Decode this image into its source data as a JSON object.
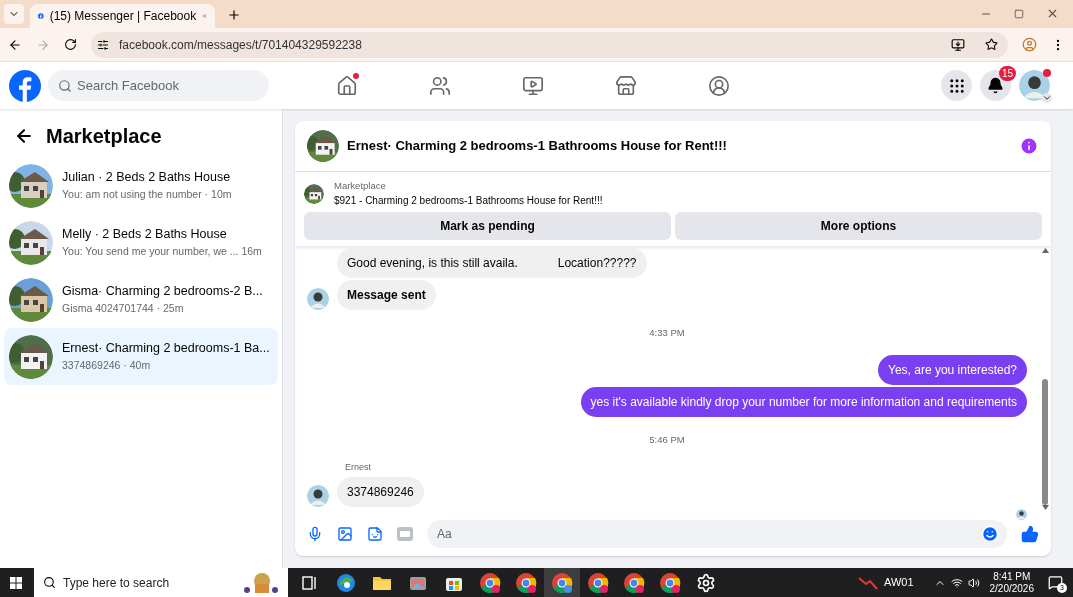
{
  "browser": {
    "tab_title": "(15) Messenger | Facebook",
    "url": "facebook.com/messages/t/701404329592238"
  },
  "header": {
    "search_placeholder": "Search Facebook",
    "nav": [
      {
        "kind": "home",
        "has_dot": true
      },
      {
        "kind": "friends",
        "has_dot": false
      },
      {
        "kind": "video",
        "has_dot": false
      },
      {
        "kind": "marketplace",
        "has_dot": false
      },
      {
        "kind": "groups",
        "has_dot": false
      }
    ],
    "notification_count": "15"
  },
  "sidebar": {
    "title": "Marketplace",
    "conversations": [
      {
        "title": "Julian · 2 Beds 2 Baths House",
        "preview": "You: am not using the number · 10m",
        "selected": false
      },
      {
        "title": "Melly · 2 Beds 2 Baths House",
        "preview": "You: You send me your number, we ...  16m",
        "selected": false
      },
      {
        "title": "Gisma· Charming 2 bedrooms-2 B...",
        "preview": "Gisma 4024701744 · 25m",
        "selected": false
      },
      {
        "title": "Ernest· Charming 2 bedrooms-1 Ba...",
        "preview": "3374869246 · 40m",
        "selected": true
      }
    ]
  },
  "chat": {
    "title": "Ernest· Charming 2 bedrooms-1 Bathrooms House for Rent!!!",
    "listing": {
      "label": "Marketplace",
      "title": "$921 - Charming 2 bedrooms-1 Bathrooms House for Rent!!!"
    },
    "buttons": [
      "Mark as pending",
      "More options"
    ],
    "messages": [
      {
        "kind": "incoming",
        "parts": [
          "Good evening, is this still availa.",
          "Location?????"
        ],
        "avatar": false
      },
      {
        "kind": "incoming",
        "parts": [
          "Message sent"
        ],
        "avatar": true,
        "bold": true
      },
      {
        "kind": "time",
        "text": "4:33 PM"
      },
      {
        "kind": "outgoing",
        "text": "Yes, are you interested?"
      },
      {
        "kind": "outgoing",
        "text": "yes it's available kindly drop your number for more information and requirements"
      },
      {
        "kind": "time",
        "text": "5:46 PM"
      },
      {
        "kind": "incoming",
        "sender": "Ernest",
        "parts": [
          "3374869246"
        ],
        "avatar": true,
        "bold": false
      }
    ],
    "composer": {
      "placeholder": "Aa"
    }
  },
  "taskbar": {
    "search_placeholder": "Type here to search",
    "apps": [
      {
        "kind": "taskview",
        "selected": false
      },
      {
        "kind": "edge",
        "selected": false
      },
      {
        "kind": "folder",
        "selected": false
      },
      {
        "kind": "photos",
        "selected": false
      },
      {
        "kind": "store",
        "selected": false
      },
      {
        "kind": "chrome",
        "selected": false
      },
      {
        "kind": "chrome",
        "selected": false
      },
      {
        "kind": "chrome",
        "selected": true
      },
      {
        "kind": "chrome",
        "selected": false
      },
      {
        "kind": "chrome",
        "selected": false
      },
      {
        "kind": "chrome",
        "selected": false
      },
      {
        "kind": "settings",
        "selected": false
      }
    ],
    "weather": "AW01",
    "time": "8:41 PM",
    "date": "2/20/2026",
    "notification_count": "3"
  }
}
